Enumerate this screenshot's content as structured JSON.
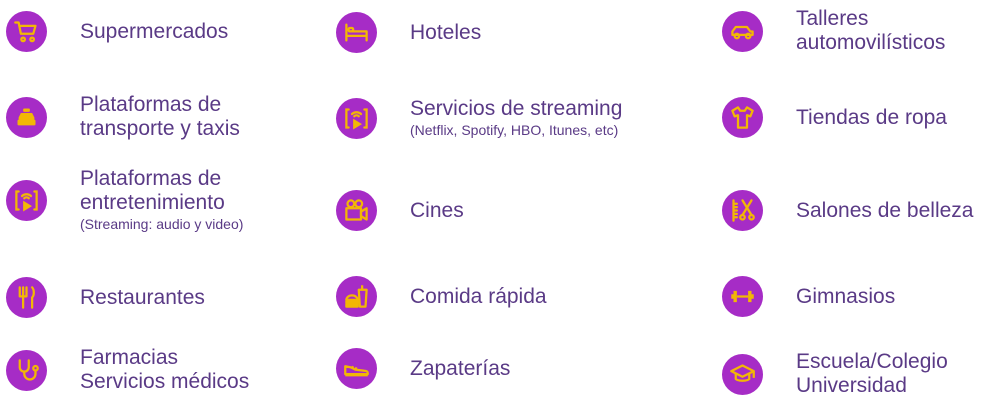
{
  "colors": {
    "circle": "#a62cc6",
    "icon": "#f2b705",
    "text": "#5a3a86"
  },
  "categories": [
    {
      "icon": "shopping-cart-icon",
      "line1": "Supermercados",
      "line2": "",
      "sub": ""
    },
    {
      "icon": "bed-icon",
      "line1": "Hoteles",
      "line2": "",
      "sub": ""
    },
    {
      "icon": "car-icon",
      "line1": "Talleres",
      "line2": "automovilísticos",
      "sub": ""
    },
    {
      "icon": "taxi-icon",
      "line1": "Plataformas de",
      "line2": "transporte y taxis",
      "sub": ""
    },
    {
      "icon": "streaming-device-icon",
      "line1": "Servicios de streaming",
      "line2": "",
      "sub": "(Netflix, Spotify, HBO, Itunes, etc)"
    },
    {
      "icon": "shirt-icon",
      "line1": "Tiendas de ropa",
      "line2": "",
      "sub": ""
    },
    {
      "icon": "streaming-device-icon",
      "line1": "Plataformas de",
      "line2": "entretenimiento",
      "sub": "(Streaming: audio y video)"
    },
    {
      "icon": "movie-camera-icon",
      "line1": "Cines",
      "line2": "",
      "sub": ""
    },
    {
      "icon": "comb-scissors-icon",
      "line1": "Salones de belleza",
      "line2": "",
      "sub": ""
    },
    {
      "icon": "fork-knife-icon",
      "line1": "Restaurantes",
      "line2": "",
      "sub": ""
    },
    {
      "icon": "fast-food-icon",
      "line1": "Comida rápida",
      "line2": "",
      "sub": ""
    },
    {
      "icon": "dumbbell-icon",
      "line1": "Gimnasios",
      "line2": "",
      "sub": ""
    },
    {
      "icon": "stethoscope-icon",
      "line1": "Farmacias",
      "line2": "Servicios médicos",
      "sub": ""
    },
    {
      "icon": "sneaker-icon",
      "line1": "Zapaterías",
      "line2": "",
      "sub": ""
    },
    {
      "icon": "graduation-cap-icon",
      "line1": "Escuela/Colegio",
      "line2": "Universidad",
      "sub": ""
    }
  ]
}
